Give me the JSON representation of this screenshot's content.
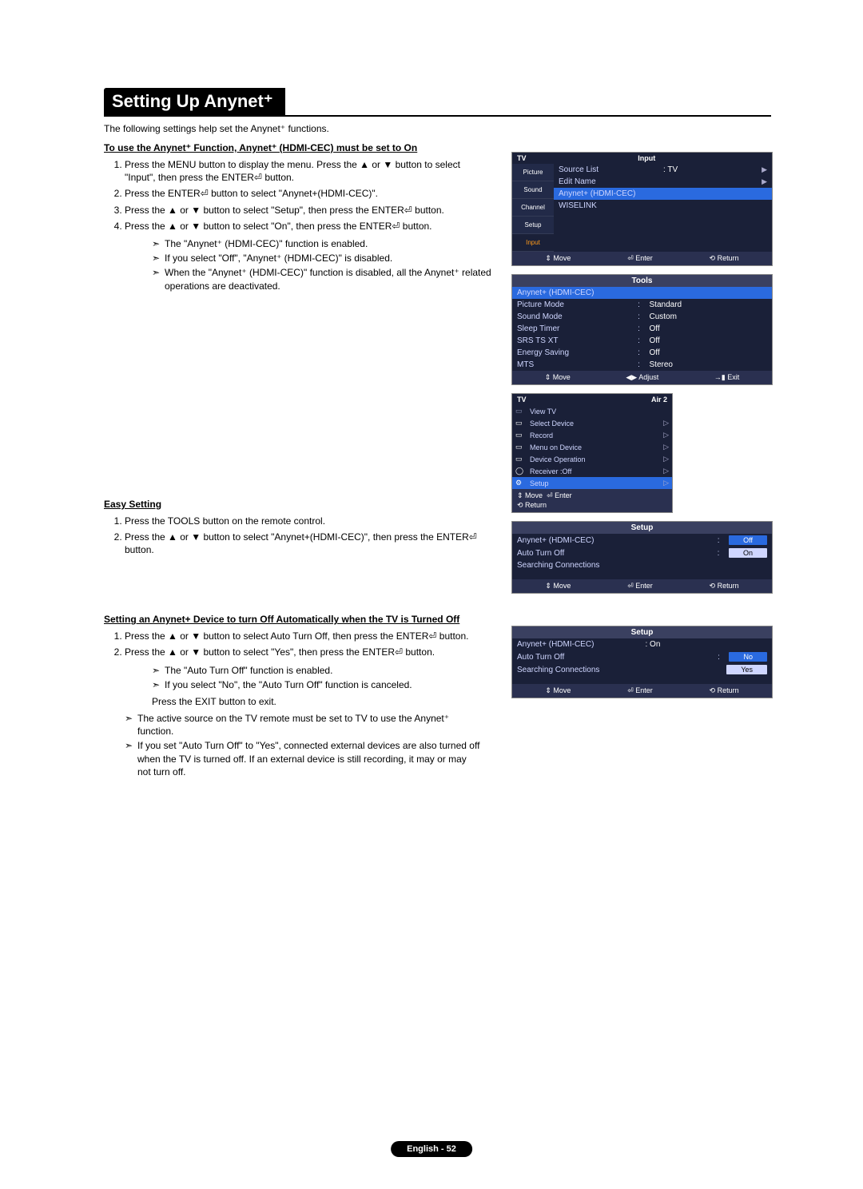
{
  "title": "Setting Up Anynet⁺",
  "intro": "The following settings help set the Anynet⁺ functions.",
  "section1": {
    "heading": "To use the Anynet⁺ Function, Anynet⁺ (HDMI-CEC) must be set to On",
    "steps": [
      "Press the MENU button to display the menu. Press the ▲ or ▼ button to select \"Input\", then press the ENTER⏎ button.",
      "Press the ENTER⏎ button to select \"Anynet+(HDMI-CEC)\".",
      "Press the ▲ or ▼ button to select \"Setup\", then press the ENTER⏎ button.",
      "Press the ▲ or ▼ button to select \"On\", then press the ENTER⏎ button."
    ],
    "notes": [
      "The \"Anynet⁺ (HDMI-CEC)\" function is enabled.",
      "If you select \"Off\", \"Anynet⁺ (HDMI-CEC)\" is disabled.",
      "When the \"Anynet⁺ (HDMI-CEC)\" function is disabled, all the Anynet⁺ related operations are deactivated."
    ]
  },
  "section2": {
    "heading": "Easy Setting",
    "steps": [
      "Press the TOOLS button on the remote control.",
      "Press the ▲ or ▼ button to select \"Anynet+(HDMI-CEC)\", then press the ENTER⏎ button."
    ]
  },
  "section3": {
    "heading": "Setting an Anynet+ Device to turn Off Automatically when the TV is Turned Off",
    "steps": [
      "Press the ▲ or ▼ button to select Auto Turn Off, then press the ENTER⏎ button.",
      "Press the ▲ or ▼ button to select \"Yes\", then press the ENTER⏎ button."
    ],
    "notes": [
      "The \"Auto Turn Off\" function is enabled.",
      "If you select \"No\", the \"Auto Turn Off\" function is canceled."
    ],
    "exit": "Press the EXIT button to exit.",
    "notes2": [
      "The active source on the TV remote must be set to TV to use the Anynet⁺ function.",
      "If you set \"Auto Turn Off\" to \"Yes\", connected external devices are also turned off when the TV is turned off. If an external device is still recording, it may or may not turn off."
    ]
  },
  "osd_input": {
    "tv": "TV",
    "title": "Input",
    "sidebar": [
      "Picture",
      "Sound",
      "Channel",
      "Setup",
      "Input"
    ],
    "rows": [
      {
        "l": "Source List",
        "v": ": TV",
        "arrow": "▶"
      },
      {
        "l": "Edit Name",
        "v": "",
        "arrow": "▶"
      },
      {
        "l": "Anynet+ (HDMI-CEC)",
        "v": "",
        "sel": true
      },
      {
        "l": "WISELINK",
        "v": ""
      }
    ],
    "footer": [
      "⇕ Move",
      "⏎ Enter",
      "⟲ Return"
    ]
  },
  "osd_tools": {
    "title": "Tools",
    "rows": [
      {
        "l": "Anynet+ (HDMI-CEC)",
        "sel": true
      },
      {
        "l": "Picture Mode",
        "v": "Standard"
      },
      {
        "l": "Sound Mode",
        "v": "Custom"
      },
      {
        "l": "Sleep Timer",
        "v": "Off"
      },
      {
        "l": "SRS TS XT",
        "v": "Off"
      },
      {
        "l": "Energy Saving",
        "v": "Off"
      },
      {
        "l": "MTS",
        "v": "Stereo"
      }
    ],
    "footer": [
      "⇕ Move",
      "◀▶ Adjust",
      "→▮ Exit"
    ]
  },
  "osd_anynet": {
    "tv": "TV",
    "air": "Air 2",
    "rows": [
      {
        "l": "View TV",
        "dim": true
      },
      {
        "l": "Select Device",
        "arrow": "▷"
      },
      {
        "l": "Record",
        "arrow": "▷"
      },
      {
        "l": "Menu on Device",
        "arrow": "▷"
      },
      {
        "l": "Device Operation",
        "arrow": "▷"
      },
      {
        "l": "Receiver    :Off",
        "arrow": "▷"
      },
      {
        "l": "Setup",
        "sel": true,
        "arrow": "▷"
      }
    ],
    "footer": [
      "⇕ Move",
      "⏎ Enter",
      "⟲ Return"
    ]
  },
  "osd_setup1": {
    "title": "Setup",
    "rows": [
      {
        "l": "Anynet+ (HDMI-CEC)",
        "v": "Off",
        "box": true,
        "sel": true
      },
      {
        "l": "Auto Turn Off",
        "v": "On",
        "box": true
      },
      {
        "l": "Searching Connections",
        "v": ""
      }
    ],
    "footer": [
      "⇕ Move",
      "⏎ Enter",
      "⟲ Return"
    ]
  },
  "osd_setup2": {
    "title": "Setup",
    "rows": [
      {
        "l": "Anynet+ (HDMI-CEC)",
        "v": ": On"
      },
      {
        "l": "Auto Turn Off",
        "v": "No",
        "box": true,
        "sel": true
      },
      {
        "l": "Searching Connections",
        "v": "Yes",
        "box": true
      }
    ],
    "footer": [
      "⇕ Move",
      "⏎ Enter",
      "⟲ Return"
    ]
  },
  "page_num": "English - 52"
}
